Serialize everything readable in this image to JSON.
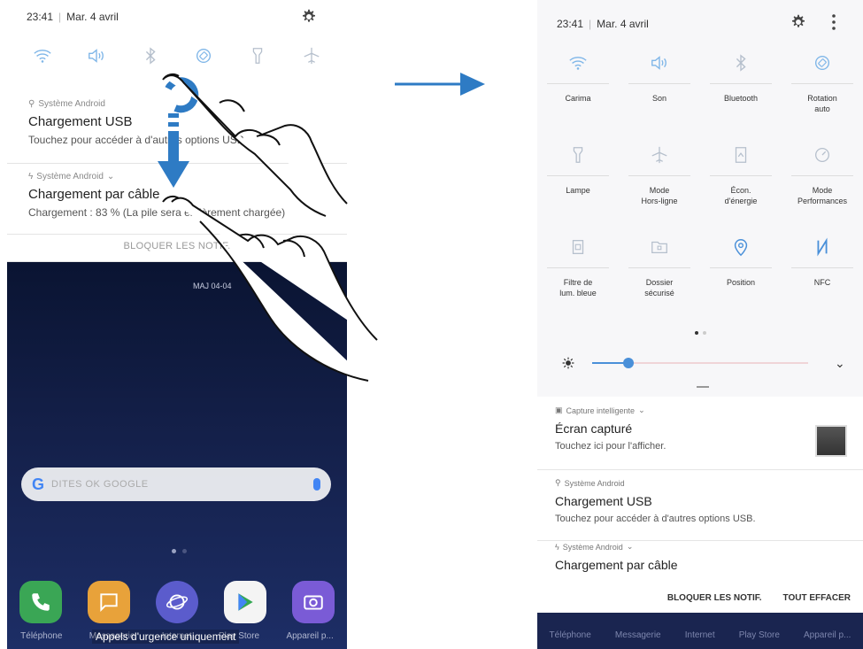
{
  "left_phone": {
    "status": {
      "time": "23:41",
      "date": "Mar. 4 avril"
    },
    "notifications": [
      {
        "source": "Système Android",
        "title": "Chargement USB",
        "subtitle": "Touchez pour accéder à d'autres options USB."
      },
      {
        "source": "Système Android",
        "title": "Chargement par câble",
        "subtitle": "Chargement : 83 % (La pile sera entièrement chargée)"
      }
    ],
    "block_label": "BLOQUER LES NOTIF.",
    "home_date": "MAJ 04-04",
    "search_placeholder": "DITES OK GOOGLE",
    "dock_labels": [
      "Téléphone",
      "Messagerie",
      "Internet",
      "Play Store",
      "Appareil p..."
    ],
    "emergency_label": "Appels d'urgence uniquement"
  },
  "right_phone": {
    "status": {
      "time": "23:41",
      "date": "Mar. 4 avril"
    },
    "tiles": [
      {
        "icon": "wifi-icon",
        "label": "Carima",
        "active": true
      },
      {
        "icon": "sound-icon",
        "label": "Son",
        "active": true
      },
      {
        "icon": "bluetooth-icon",
        "label": "Bluetooth",
        "active": false
      },
      {
        "icon": "rotation-icon",
        "label": "Rotation\nauto",
        "active": true
      },
      {
        "icon": "flashlight-icon",
        "label": "Lampe",
        "active": false
      },
      {
        "icon": "airplane-icon",
        "label": "Mode\nHors-ligne",
        "active": false
      },
      {
        "icon": "battery-saver-icon",
        "label": "Écon.\nd'énergie",
        "active": false
      },
      {
        "icon": "performance-icon",
        "label": "Mode\nPerformances",
        "active": false
      },
      {
        "icon": "blue-light-filter-icon",
        "label": "Filtre de\nlum. bleue",
        "active": false
      },
      {
        "icon": "secure-folder-icon",
        "label": "Dossier\nsécurisé",
        "active": false
      },
      {
        "icon": "location-icon",
        "label": "Position",
        "active": true
      },
      {
        "icon": "nfc-icon",
        "label": "NFC",
        "active": true
      }
    ],
    "brightness_level": 0.17,
    "notifications": [
      {
        "source": "Capture intelligente",
        "title": "Écran capturé",
        "subtitle": "Touchez ici pour l'afficher."
      },
      {
        "source": "Système Android",
        "title": "Chargement USB",
        "subtitle": "Touchez pour accéder à d'autres options USB."
      },
      {
        "source": "Système Android",
        "title": "Chargement par câble",
        "subtitle": ""
      }
    ],
    "actions": {
      "block": "BLOQUER LES NOTIF.",
      "clear": "TOUT EFFACER"
    },
    "dock_labels": [
      "Téléphone",
      "Messagerie",
      "Internet",
      "Play Store",
      "Appareil p..."
    ]
  },
  "colors": {
    "accent": "#4a90d9",
    "inactive": "#b5bfcc",
    "arrow": "#2e7bc4",
    "text": "#222222"
  }
}
